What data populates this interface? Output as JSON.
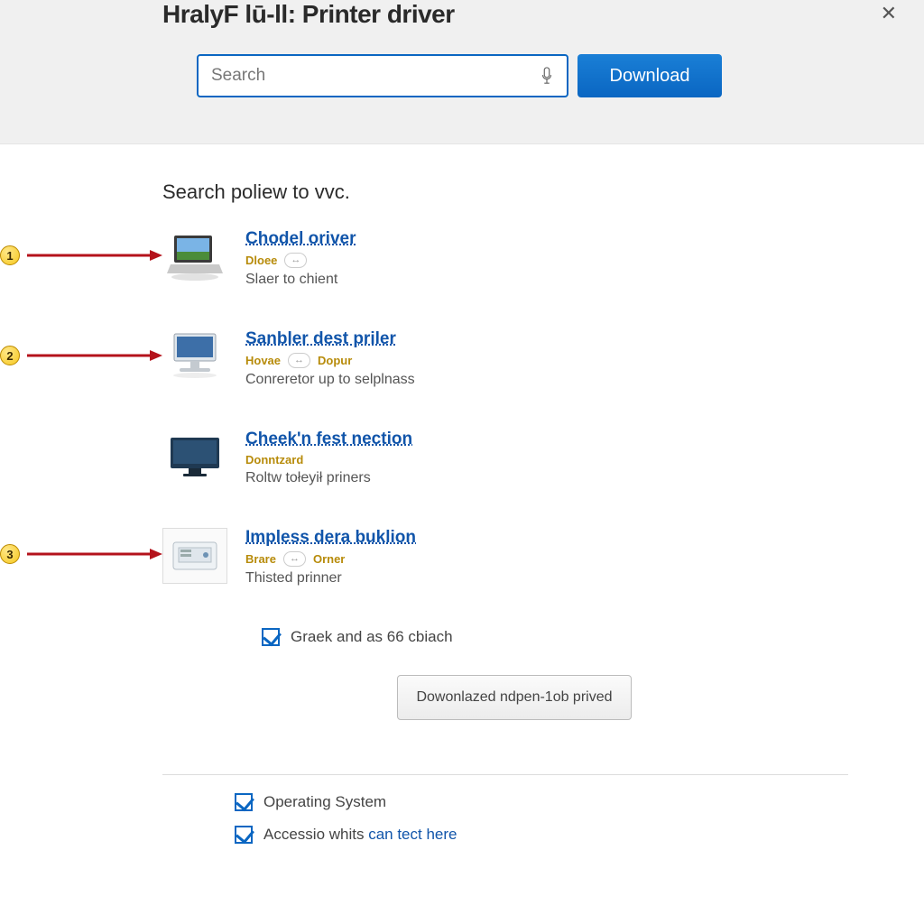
{
  "header": {
    "title": "HralyF lū-ll: Printer driver",
    "search_placeholder": "Search",
    "download_label": "Download"
  },
  "subheading": "Search poliew to vvc.",
  "results": [
    {
      "callout_number": "1",
      "title": "Chodel oriver",
      "meta_tags": [
        "Dloee"
      ],
      "meta_chip": "↔",
      "description": "Slaer to chient",
      "icon": "laptop"
    },
    {
      "callout_number": "2",
      "title": "Sanbler dest priler",
      "meta_tags": [
        "Hovae",
        "Dopur"
      ],
      "meta_chip": "↔",
      "description": "Conreretor up to selplnass",
      "icon": "desktop"
    },
    {
      "callout_number": null,
      "title": "Cheek'n fest nection",
      "meta_tags": [
        "Donntzard"
      ],
      "meta_chip": null,
      "description": "Roltw tołeyił priners",
      "icon": "monitor"
    },
    {
      "callout_number": "3",
      "title": "Impless dera buklion",
      "meta_tags": [
        "Brare",
        "Orner"
      ],
      "meta_chip": "↔",
      "description": "Thisted prinner",
      "icon": "printer"
    }
  ],
  "option_checkbox_label": "Graek and as 66 cbiach",
  "download_button_label": "Dowonlazed ndpen-1ob prived",
  "footer": {
    "os_label": "Operating System",
    "access_prefix": "Accessio whits ",
    "access_link": "can tect here"
  }
}
